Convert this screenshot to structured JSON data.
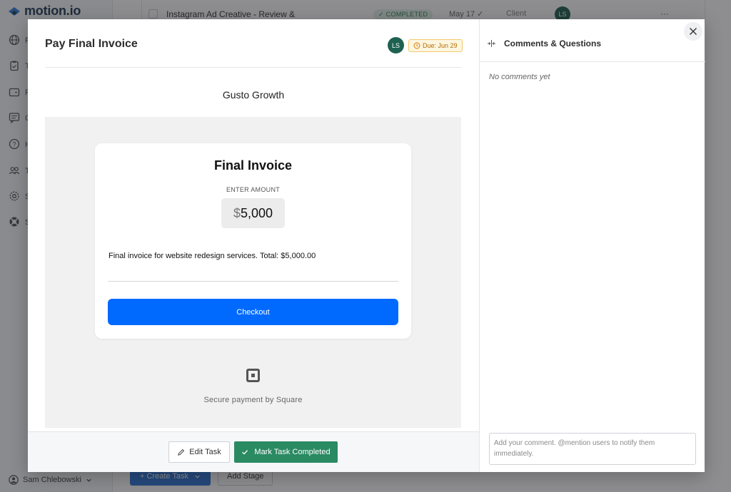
{
  "background": {
    "logo_text": "motion.io",
    "sidebar_letters": [
      "P",
      "T",
      "F",
      "C",
      "H",
      "T",
      "S",
      "S"
    ],
    "user_name": "Sam Chlebowski",
    "task_row": {
      "title": "Instagram Ad Creative - Review &",
      "status": "✓ COMPLETED",
      "date": "May 17 ✓",
      "assignee_label": "Client",
      "avatar": "LS",
      "more": "···"
    },
    "create_task_label": "+   Create Task",
    "add_stage_label": "Add Stage"
  },
  "modal": {
    "title": "Pay Final Invoice",
    "assignee_initials": "LS",
    "due_label": "Due: Jun 29",
    "company": "Gusto Growth",
    "invoice": {
      "title": "Final Invoice",
      "amount_label": "ENTER AMOUNT",
      "currency": "$",
      "amount": "5,000",
      "description": "Final invoice for website redesign services. Total: $5,000.00",
      "checkout_label": "Checkout"
    },
    "secure_text": "Secure payment by Square",
    "edit_label": "Edit Task",
    "complete_label": "Mark Task Completed"
  },
  "comments": {
    "title": "Comments & Questions",
    "empty_text": "No comments yet",
    "input_placeholder": "Add your comment. @mention users to notify them immediately."
  },
  "colors": {
    "accent_green": "#2a8a62",
    "square_blue": "#006aff",
    "avatar_green": "#1e6150",
    "due_orange": "#b36b00"
  }
}
